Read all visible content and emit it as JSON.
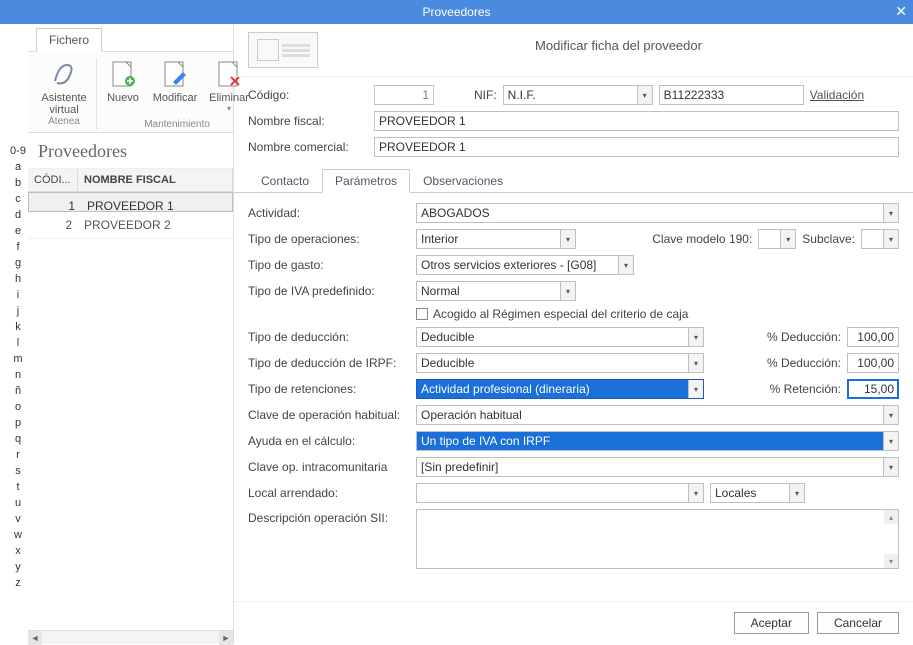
{
  "title": "Proveedores",
  "subtitle": "Modificar ficha del proveedor",
  "file_tab": "Fichero",
  "ribbon": {
    "group1": {
      "assistant_label": "Asistente virtual",
      "brand": "Atenea"
    },
    "group2": {
      "name": "Mantenimiento",
      "new": "Nuevo",
      "modify": "Modificar",
      "delete": "Eliminar"
    }
  },
  "alpha": [
    "0-9",
    "a",
    "b",
    "c",
    "d",
    "e",
    "f",
    "g",
    "h",
    "i",
    "j",
    "k",
    "l",
    "m",
    "n",
    "ñ",
    "o",
    "p",
    "q",
    "r",
    "s",
    "t",
    "u",
    "v",
    "w",
    "x",
    "y",
    "z"
  ],
  "list": {
    "header": "Proveedores",
    "cols": {
      "code": "CÓDI...",
      "name": "NOMBRE FISCAL"
    },
    "rows": [
      {
        "code": "1",
        "name": "PROVEEDOR 1",
        "selected": true
      },
      {
        "code": "2",
        "name": "PROVEEDOR 2",
        "selected": false
      }
    ]
  },
  "form": {
    "codigo_lbl": "Código:",
    "codigo_val": "1",
    "nif_lbl": "NIF:",
    "nif_type": "N.I.F.",
    "nif_val": "B11222333",
    "validacion": "Validación",
    "nombre_fiscal_lbl": "Nombre fiscal:",
    "nombre_fiscal_val": "PROVEEDOR 1",
    "nombre_com_lbl": "Nombre comercial:",
    "nombre_com_val": "PROVEEDOR 1"
  },
  "tabs": {
    "contacto": "Contacto",
    "parametros": "Parámetros",
    "observ": "Observaciones"
  },
  "params": {
    "actividad_lbl": "Actividad:",
    "actividad": "ABOGADOS",
    "tipo_op_lbl": "Tipo de operaciones:",
    "tipo_op": "Interior",
    "clave190_lbl": "Clave modelo 190:",
    "subclave_lbl": "Subclave:",
    "tipo_gasto_lbl": "Tipo de gasto:",
    "tipo_gasto": "Otros servicios exteriores - [G08]",
    "tipo_iva_lbl": "Tipo de IVA predefinido:",
    "tipo_iva": "Normal",
    "criterio_caja": "Acogido al Régimen especial del criterio de caja",
    "tipo_ded_lbl": "Tipo de deducción:",
    "tipo_ded": "Deducible",
    "pct_ded_lbl": "% Deducción:",
    "pct_ded": "100,00",
    "tipo_ded_irpf_lbl": "Tipo de deducción de IRPF:",
    "tipo_ded_irpf": "Deducible",
    "pct_ded2": "100,00",
    "tipo_ret_lbl": "Tipo de retenciones:",
    "tipo_ret": "Actividad profesional (dineraria)",
    "pct_ret_lbl": "% Retención:",
    "pct_ret": "15,00",
    "clave_op_lbl": "Clave de operación habitual:",
    "clave_op": "Operación habitual",
    "ayuda_lbl": "Ayuda en el cálculo:",
    "ayuda": "Un tipo de IVA con IRPF",
    "clave_intra_lbl": "Clave op. intracomunitaria",
    "clave_intra": "[Sin predefinir]",
    "local_lbl": "Local arrendado:",
    "locales": "Locales",
    "desc_sii_lbl": "Descripción operación SII:"
  },
  "buttons": {
    "accept": "Aceptar",
    "cancel": "Cancelar"
  }
}
